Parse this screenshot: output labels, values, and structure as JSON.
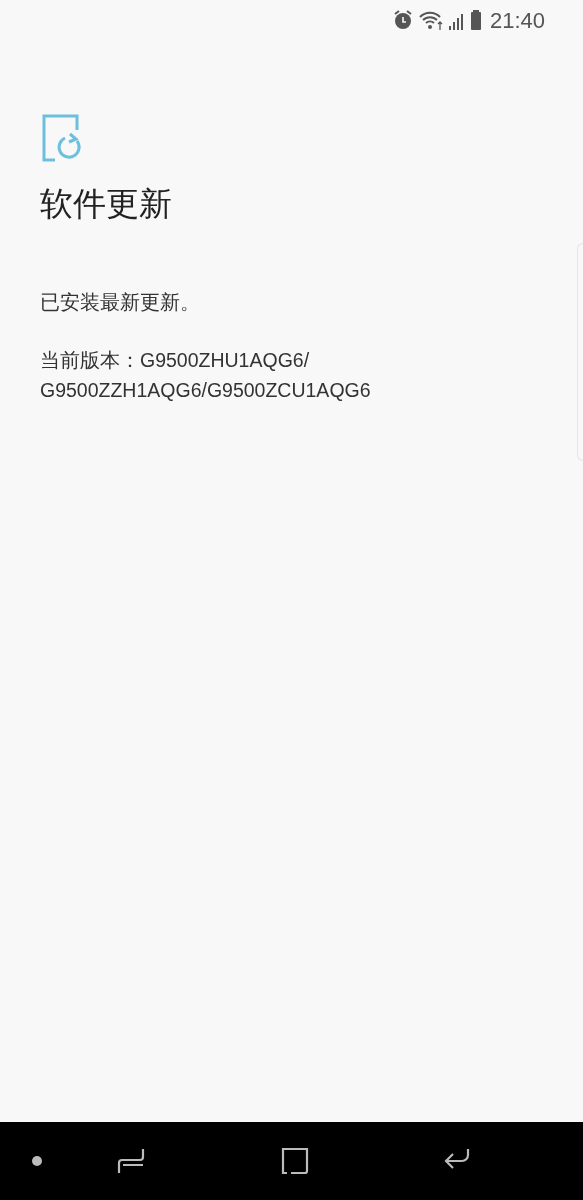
{
  "status_bar": {
    "time": "21:40"
  },
  "page": {
    "title": "软件更新",
    "message": "已安装最新更新。",
    "version_lines": [
      "当前版本：G9500ZHU1AQG6/",
      "G9500ZZH1AQG6/G9500ZCU1AQG6"
    ]
  },
  "nav_bar": {
    "buttons": [
      {
        "kind": "dot"
      },
      {
        "kind": "recent"
      },
      {
        "kind": "home"
      },
      {
        "kind": "back"
      }
    ]
  }
}
